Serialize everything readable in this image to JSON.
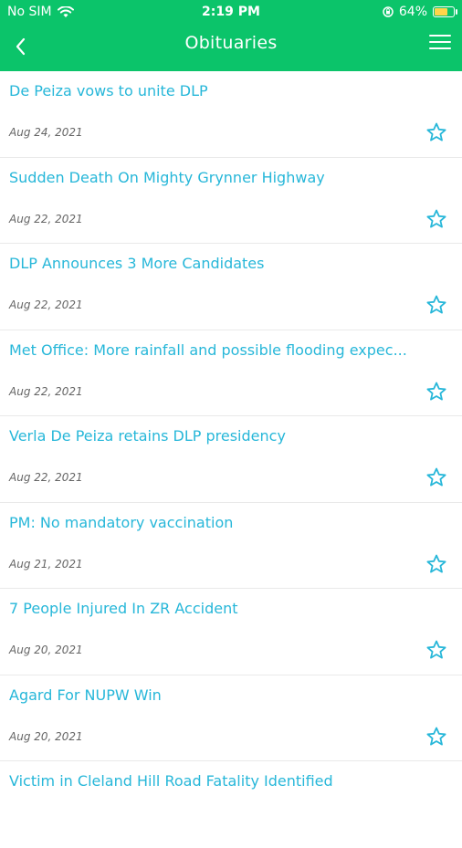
{
  "status_bar": {
    "carrier": "No SIM",
    "time": "2:19 PM",
    "battery": "64%",
    "battery_level": 0.64
  },
  "header": {
    "title": "Obituaries",
    "background": "#0bc46a",
    "back_icon": "chevron-left-icon",
    "menu_icon": "hamburger-menu-icon"
  },
  "accent_color": "#27b7d9",
  "articles": [
    {
      "title": "De Peiza vows to unite DLP",
      "date": "Aug 24, 2021"
    },
    {
      "title": "Sudden Death On Mighty Grynner Highway",
      "date": "Aug 22, 2021"
    },
    {
      "title": "DLP Announces 3 More Candidates",
      "date": "Aug 22, 2021"
    },
    {
      "title": "Met Office: More rainfall and possible flooding expec...",
      "date": "Aug 22, 2021"
    },
    {
      "title": "Verla De Peiza retains DLP presidency",
      "date": "Aug 22, 2021"
    },
    {
      "title": "PM: No mandatory vaccination",
      "date": "Aug 21, 2021"
    },
    {
      "title": "7 People Injured In ZR Accident",
      "date": "Aug 20, 2021"
    },
    {
      "title": "Agard For NUPW Win",
      "date": "Aug 20, 2021"
    },
    {
      "title": "Victim in Cleland Hill Road Fatality Identified",
      "date": ""
    }
  ]
}
